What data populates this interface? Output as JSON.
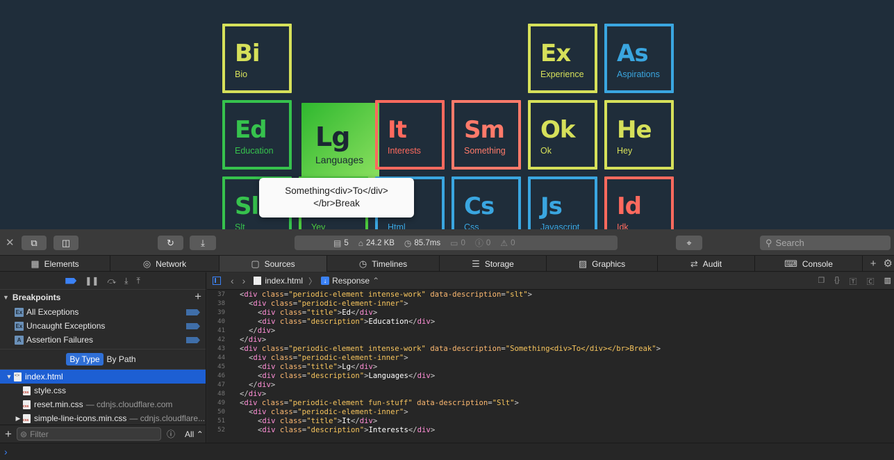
{
  "colors": {
    "page_bg": "#1f2d3a",
    "accent": "#2f6fd6"
  },
  "tiles": [
    {
      "symbol": "Bi",
      "description": "Bio",
      "color": "#d6e05a",
      "col": 0,
      "row": 0
    },
    {
      "symbol": "Ex",
      "description": "Experience",
      "color": "#d6e05a",
      "col": 4,
      "row": 0
    },
    {
      "symbol": "As",
      "description": "Aspirations",
      "color": "#3aa6e0",
      "col": 5,
      "row": 0
    },
    {
      "symbol": "Ed",
      "description": "Education",
      "color": "#36c24d",
      "col": 0,
      "row": 1
    },
    {
      "symbol": "Lg",
      "description": "Languages",
      "color": "#4cc93e",
      "col": 1,
      "row": 1,
      "active": true
    },
    {
      "symbol": "It",
      "description": "Interests",
      "color": "#ff6a5e",
      "col": 2,
      "row": 1
    },
    {
      "symbol": "Sm",
      "description": "Something",
      "color": "#ff7a6a",
      "col": 3,
      "row": 1
    },
    {
      "symbol": "Ok",
      "description": "Ok",
      "color": "#d6e05a",
      "col": 4,
      "row": 1
    },
    {
      "symbol": "He",
      "description": "Hey",
      "color": "#d6e05a",
      "col": 5,
      "row": 1
    },
    {
      "symbol": "Sl",
      "description": "Slt",
      "color": "#36c24d",
      "col": 0,
      "row": 2
    },
    {
      "symbol": "",
      "description": "Yey",
      "color": "#4cc93e",
      "col": 1,
      "row": 2
    },
    {
      "symbol": "",
      "description": "Html",
      "color": "#3aa6e0",
      "col": 2,
      "row": 2
    },
    {
      "symbol": "Cs",
      "description": "Css",
      "color": "#3aa6e0",
      "col": 3,
      "row": 2
    },
    {
      "symbol": "Js",
      "description": "Javascript",
      "color": "#3aa6e0",
      "col": 4,
      "row": 2
    },
    {
      "symbol": "Id",
      "description": "Idk",
      "color": "#ff6a5e",
      "col": 5,
      "row": 2
    }
  ],
  "tooltip": {
    "line1": "Something<div>To</div>",
    "line2": "</br>Break"
  },
  "toolbar": {
    "resources": "5",
    "size": "24.2 KB",
    "time": "85.7ms",
    "logs": "0",
    "errors": "0",
    "warnings": "0",
    "search_placeholder": "Search"
  },
  "tabs": [
    {
      "label": "Elements",
      "icon": "▦"
    },
    {
      "label": "Network",
      "icon": "◎"
    },
    {
      "label": "Sources",
      "icon": "▢",
      "selected": true
    },
    {
      "label": "Timelines",
      "icon": "◷"
    },
    {
      "label": "Storage",
      "icon": "☰"
    },
    {
      "label": "Graphics",
      "icon": "▨"
    },
    {
      "label": "Audit",
      "icon": "⇄"
    },
    {
      "label": "Console",
      "icon": "⌨"
    }
  ],
  "navigator": {
    "breakpoints_title": "Breakpoints",
    "breakpoints": [
      {
        "label": "All Exceptions",
        "badge": "Ex"
      },
      {
        "label": "Uncaught Exceptions",
        "badge": "Ex"
      },
      {
        "label": "Assertion Failures",
        "badge": "A"
      }
    ],
    "group_by_type": "By Type",
    "group_by_path": "By Path",
    "files": [
      {
        "name": "index.html",
        "host": "",
        "icon": "html",
        "selected": true,
        "indent": 0,
        "tri": "▼"
      },
      {
        "name": "style.css",
        "host": "",
        "icon": "css",
        "indent": 1,
        "tri": ""
      },
      {
        "name": "reset.min.css",
        "host": "— cdnjs.cloudflare.com",
        "icon": "css",
        "indent": 1,
        "tri": ""
      },
      {
        "name": "simple-line-icons.min.css",
        "host": "— cdnjs.cloudflare...",
        "icon": "css",
        "indent": 1,
        "tri": "▶"
      }
    ],
    "filter_placeholder": "Filter",
    "filter_scope": "All"
  },
  "content": {
    "file": "index.html",
    "mode": "Response"
  },
  "code_lines": [
    {
      "n": "37",
      "indent": 0,
      "parts": [
        [
          "p",
          "<"
        ],
        [
          "t",
          "div "
        ],
        [
          "a",
          "class"
        ],
        [
          "p",
          "="
        ],
        [
          "v",
          "\"periodic-element intense-work\" "
        ],
        [
          "a",
          "data-description"
        ],
        [
          "p",
          "="
        ],
        [
          "v",
          "\"slt\""
        ],
        [
          "p",
          ">"
        ]
      ]
    },
    {
      "n": "38",
      "indent": 1,
      "parts": [
        [
          "p",
          "<"
        ],
        [
          "t",
          "div "
        ],
        [
          "a",
          "class"
        ],
        [
          "p",
          "="
        ],
        [
          "v",
          "\"periodic-element-inner\""
        ],
        [
          "p",
          ">"
        ]
      ]
    },
    {
      "n": "39",
      "indent": 2,
      "parts": [
        [
          "p",
          "<"
        ],
        [
          "t",
          "div "
        ],
        [
          "a",
          "class"
        ],
        [
          "p",
          "="
        ],
        [
          "v",
          "\"title\""
        ],
        [
          "p",
          ">"
        ],
        [
          "txt",
          "Ed"
        ],
        [
          "p",
          "</"
        ],
        [
          "t",
          "div"
        ],
        [
          "p",
          ">"
        ]
      ]
    },
    {
      "n": "40",
      "indent": 2,
      "parts": [
        [
          "p",
          "<"
        ],
        [
          "t",
          "div "
        ],
        [
          "a",
          "class"
        ],
        [
          "p",
          "="
        ],
        [
          "v",
          "\"description\""
        ],
        [
          "p",
          ">"
        ],
        [
          "txt",
          "Education"
        ],
        [
          "p",
          "</"
        ],
        [
          "t",
          "div"
        ],
        [
          "p",
          ">"
        ]
      ]
    },
    {
      "n": "41",
      "indent": 1,
      "parts": [
        [
          "p",
          "</"
        ],
        [
          "t",
          "div"
        ],
        [
          "p",
          ">"
        ]
      ]
    },
    {
      "n": "42",
      "indent": 0,
      "parts": [
        [
          "p",
          "</"
        ],
        [
          "t",
          "div"
        ],
        [
          "p",
          ">"
        ]
      ]
    },
    {
      "n": "43",
      "indent": 0,
      "parts": [
        [
          "p",
          "<"
        ],
        [
          "t",
          "div "
        ],
        [
          "a",
          "class"
        ],
        [
          "p",
          "="
        ],
        [
          "v",
          "\"periodic-element intense-work\" "
        ],
        [
          "a",
          "data-description"
        ],
        [
          "p",
          "="
        ],
        [
          "v",
          "\"Something<div>To</div></br>Break\""
        ],
        [
          "p",
          ">"
        ]
      ]
    },
    {
      "n": "44",
      "indent": 1,
      "parts": [
        [
          "p",
          "<"
        ],
        [
          "t",
          "div "
        ],
        [
          "a",
          "class"
        ],
        [
          "p",
          "="
        ],
        [
          "v",
          "\"periodic-element-inner\""
        ],
        [
          "p",
          ">"
        ]
      ]
    },
    {
      "n": "45",
      "indent": 2,
      "parts": [
        [
          "p",
          "<"
        ],
        [
          "t",
          "div "
        ],
        [
          "a",
          "class"
        ],
        [
          "p",
          "="
        ],
        [
          "v",
          "\"title\""
        ],
        [
          "p",
          ">"
        ],
        [
          "txt",
          "Lg"
        ],
        [
          "p",
          "</"
        ],
        [
          "t",
          "div"
        ],
        [
          "p",
          ">"
        ]
      ]
    },
    {
      "n": "46",
      "indent": 2,
      "parts": [
        [
          "p",
          "<"
        ],
        [
          "t",
          "div "
        ],
        [
          "a",
          "class"
        ],
        [
          "p",
          "="
        ],
        [
          "v",
          "\"description\""
        ],
        [
          "p",
          ">"
        ],
        [
          "txt",
          "Languages"
        ],
        [
          "p",
          "</"
        ],
        [
          "t",
          "div"
        ],
        [
          "p",
          ">"
        ]
      ]
    },
    {
      "n": "47",
      "indent": 1,
      "parts": [
        [
          "p",
          "</"
        ],
        [
          "t",
          "div"
        ],
        [
          "p",
          ">"
        ]
      ]
    },
    {
      "n": "48",
      "indent": 0,
      "parts": [
        [
          "p",
          "</"
        ],
        [
          "t",
          "div"
        ],
        [
          "p",
          ">"
        ]
      ]
    },
    {
      "n": "49",
      "indent": 0,
      "parts": [
        [
          "p",
          "<"
        ],
        [
          "t",
          "div "
        ],
        [
          "a",
          "class"
        ],
        [
          "p",
          "="
        ],
        [
          "v",
          "\"periodic-element fun-stuff\" "
        ],
        [
          "a",
          "data-description"
        ],
        [
          "p",
          "="
        ],
        [
          "v",
          "\"Slt\""
        ],
        [
          "p",
          ">"
        ]
      ]
    },
    {
      "n": "50",
      "indent": 1,
      "parts": [
        [
          "p",
          "<"
        ],
        [
          "t",
          "div "
        ],
        [
          "a",
          "class"
        ],
        [
          "p",
          "="
        ],
        [
          "v",
          "\"periodic-element-inner\""
        ],
        [
          "p",
          ">"
        ]
      ]
    },
    {
      "n": "51",
      "indent": 2,
      "parts": [
        [
          "p",
          "<"
        ],
        [
          "t",
          "div "
        ],
        [
          "a",
          "class"
        ],
        [
          "p",
          "="
        ],
        [
          "v",
          "\"title\""
        ],
        [
          "p",
          ">"
        ],
        [
          "txt",
          "It"
        ],
        [
          "p",
          "</"
        ],
        [
          "t",
          "div"
        ],
        [
          "p",
          ">"
        ]
      ]
    },
    {
      "n": "52",
      "indent": 2,
      "parts": [
        [
          "p",
          "<"
        ],
        [
          "t",
          "div "
        ],
        [
          "a",
          "class"
        ],
        [
          "p",
          "="
        ],
        [
          "v",
          "\"description\""
        ],
        [
          "p",
          ">"
        ],
        [
          "txt",
          "Interests"
        ],
        [
          "p",
          "</"
        ],
        [
          "t",
          "div"
        ],
        [
          "p",
          ">"
        ]
      ]
    }
  ],
  "console_prompt": "›"
}
